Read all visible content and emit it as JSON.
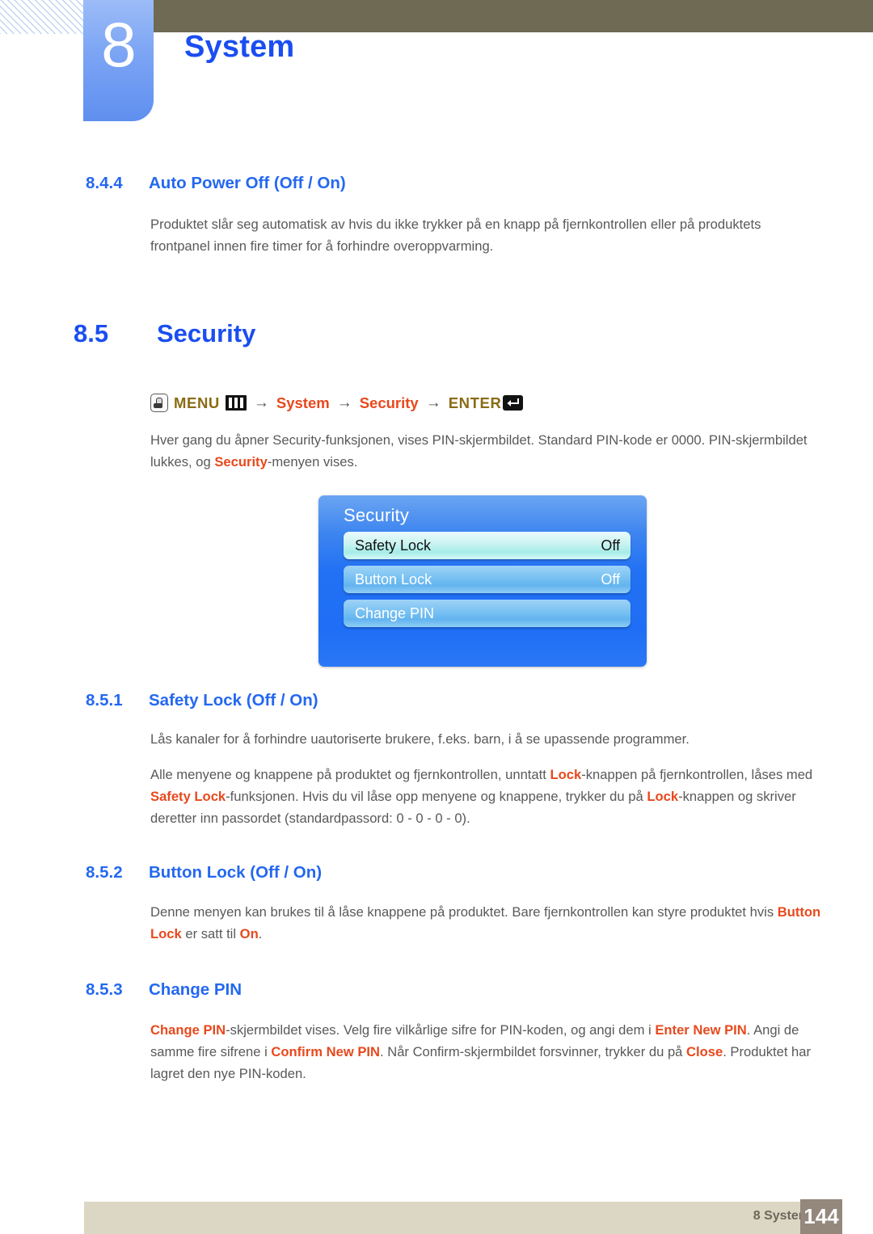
{
  "header": {
    "chapter_number": "8",
    "chapter_title": "System"
  },
  "sections": {
    "s844": {
      "number": "8.4.4",
      "title": "Auto Power Off (Off / On)",
      "paragraph": "Produktet slår seg automatisk av hvis du ikke trykker på en knapp på fjernkontrollen eller på produktets frontpanel innen fire timer for å forhindre overoppvarming."
    },
    "s85": {
      "number": "8.5",
      "title": "Security",
      "menu_path": {
        "touch_icon": "touch-button-icon",
        "menu_label": "MENU",
        "menu_icon": "menu-bars-icon",
        "arrow": "→",
        "item1": "System",
        "item2": "Security",
        "enter_label": "ENTER",
        "enter_icon": "enter-return-icon"
      },
      "paragraph_prefix": "Hver gang du åpner Security-funksjonen, vises PIN-skjermbildet. Standard PIN-kode er 0000. PIN-skjermbildet lukkes, og ",
      "paragraph_em": "Security",
      "paragraph_suffix": "-menyen vises."
    },
    "s851": {
      "number": "8.5.1",
      "title": "Safety Lock (Off / On)",
      "paragraph1": "Lås kanaler for å forhindre uautoriserte brukere, f.eks. barn, i å se upassende programmer.",
      "p2_a": "Alle menyene og knappene på produktet og fjernkontrollen, unntatt ",
      "p2_em1": "Lock",
      "p2_b": "-knappen på fjernkontrollen, låses med ",
      "p2_em2": "Safety Lock",
      "p2_c": "-funksjonen. Hvis du vil låse opp menyene og knappene, trykker du på ",
      "p2_em3": "Lock",
      "p2_d": "-knappen og skriver deretter inn passordet (standardpassord: 0 - 0 - 0 - 0)."
    },
    "s852": {
      "number": "8.5.2",
      "title": "Button Lock (Off / On)",
      "p_a": "Denne menyen kan brukes til å låse knappene på produktet. Bare fjernkontrollen kan styre produktet hvis ",
      "p_em1": "Button Lock",
      "p_b": " er satt til ",
      "p_em2": "On",
      "p_c": "."
    },
    "s853": {
      "number": "8.5.3",
      "title": "Change PIN",
      "p_em1": "Change PIN",
      "p_a": "-skjermbildet vises. Velg fire vilkårlige sifre for PIN-koden, og angi dem i ",
      "p_em2": "Enter New PIN",
      "p_b": ". Angi de samme fire sifrene i ",
      "p_em3": "Confirm New PIN",
      "p_c": ". Når Confirm-skjermbildet forsvinner, trykker du på ",
      "p_em4": "Close",
      "p_d": ". Produktet har lagret den nye PIN-koden."
    }
  },
  "osd": {
    "title": "Security",
    "rows": [
      {
        "label": "Safety Lock",
        "value": "Off",
        "selected": true
      },
      {
        "label": "Button Lock",
        "value": "Off",
        "selected": false
      },
      {
        "label": "Change PIN",
        "value": "",
        "selected": false
      }
    ]
  },
  "footer": {
    "label": "8 System",
    "page": "144"
  },
  "colors": {
    "heading_blue": "#1a4ef0",
    "subheading_blue": "#2468f0",
    "emphasis_red": "#e8491d",
    "menu_olive": "#8a6b15",
    "top_bar": "#6e6a53",
    "tab_blue": "#7ba4f4",
    "footer_band": "#dcd7c4",
    "footer_page_box": "#94877c",
    "osd_blue": "#2271f4"
  }
}
